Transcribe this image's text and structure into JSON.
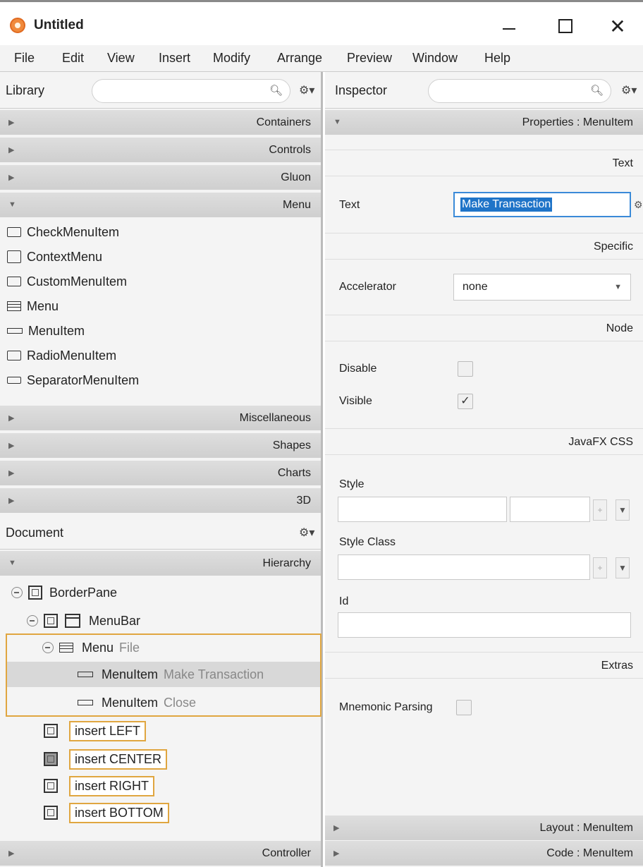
{
  "window": {
    "title": "Untitled"
  },
  "menubar": [
    "File",
    "Edit",
    "View",
    "Insert",
    "Modify",
    "Arrange",
    "Preview",
    "Window",
    "Help"
  ],
  "library": {
    "title": "Library",
    "sections_top": [
      "Containers",
      "Controls",
      "Gluon"
    ],
    "menu_section": "Menu",
    "items": [
      "CheckMenuItem",
      "ContextMenu",
      "CustomMenuItem",
      "Menu",
      "MenuItem",
      "RadioMenuItem",
      "SeparatorMenuItem"
    ],
    "sections_bottom": [
      "Miscellaneous",
      "Shapes",
      "Charts",
      "3D"
    ]
  },
  "document": {
    "title": "Document",
    "hierarchy_label": "Hierarchy",
    "rows": {
      "borderpane": "BorderPane",
      "menubar": "MenuBar",
      "menu": "Menu",
      "menu_text": "File",
      "mi1": "MenuItem",
      "mi1_text": "Make Transaction",
      "mi2": "MenuItem",
      "mi2_text": "Close"
    },
    "inserts": [
      "insert LEFT",
      "insert CENTER",
      "insert RIGHT",
      "insert BOTTOM"
    ],
    "controller_label": "Controller"
  },
  "inspector": {
    "title": "Inspector",
    "properties_header": "Properties : MenuItem",
    "text_section": "Text",
    "text_label": "Text",
    "text_value": "Make Transaction",
    "specific_section": "Specific",
    "accelerator_label": "Accelerator",
    "accelerator_value": "none",
    "node_section": "Node",
    "disable_label": "Disable",
    "visible_label": "Visible",
    "css_section": "JavaFX CSS",
    "style_label": "Style",
    "style_class_label": "Style Class",
    "id_label": "Id",
    "extras_section": "Extras",
    "mnemonic_label": "Mnemonic Parsing",
    "layout_header": "Layout : MenuItem",
    "code_header": "Code : MenuItem"
  }
}
